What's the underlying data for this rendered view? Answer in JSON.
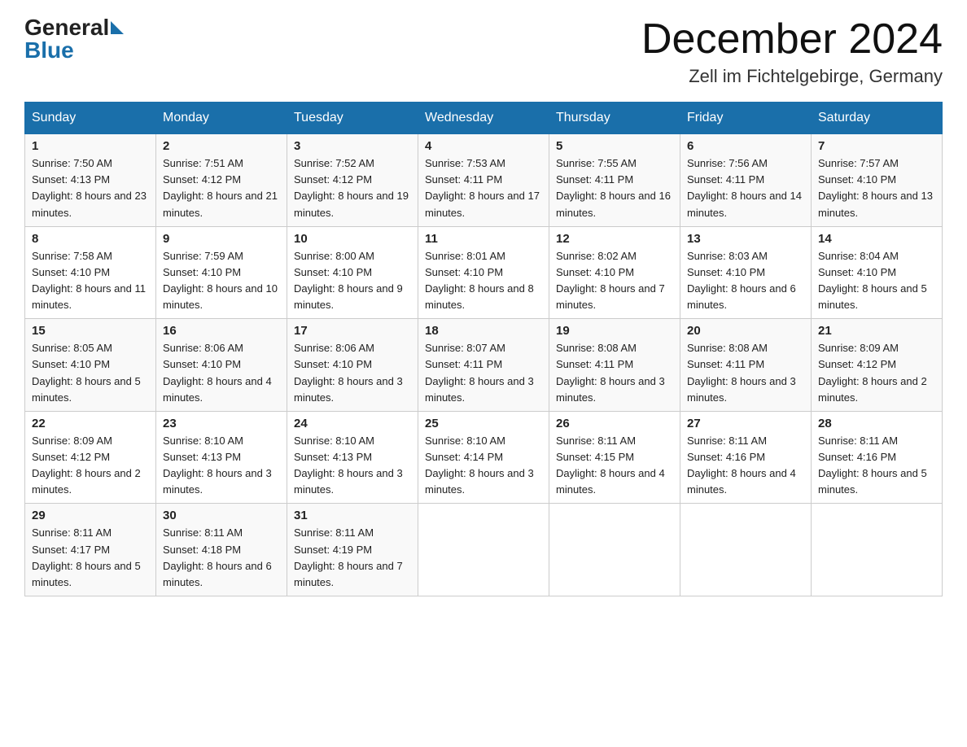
{
  "header": {
    "logo_general": "General",
    "logo_blue": "Blue",
    "month_title": "December 2024",
    "location": "Zell im Fichtelgebirge, Germany"
  },
  "days_of_week": [
    "Sunday",
    "Monday",
    "Tuesday",
    "Wednesday",
    "Thursday",
    "Friday",
    "Saturday"
  ],
  "weeks": [
    [
      {
        "day": "1",
        "sunrise": "7:50 AM",
        "sunset": "4:13 PM",
        "daylight": "8 hours and 23 minutes."
      },
      {
        "day": "2",
        "sunrise": "7:51 AM",
        "sunset": "4:12 PM",
        "daylight": "8 hours and 21 minutes."
      },
      {
        "day": "3",
        "sunrise": "7:52 AM",
        "sunset": "4:12 PM",
        "daylight": "8 hours and 19 minutes."
      },
      {
        "day": "4",
        "sunrise": "7:53 AM",
        "sunset": "4:11 PM",
        "daylight": "8 hours and 17 minutes."
      },
      {
        "day": "5",
        "sunrise": "7:55 AM",
        "sunset": "4:11 PM",
        "daylight": "8 hours and 16 minutes."
      },
      {
        "day": "6",
        "sunrise": "7:56 AM",
        "sunset": "4:11 PM",
        "daylight": "8 hours and 14 minutes."
      },
      {
        "day": "7",
        "sunrise": "7:57 AM",
        "sunset": "4:10 PM",
        "daylight": "8 hours and 13 minutes."
      }
    ],
    [
      {
        "day": "8",
        "sunrise": "7:58 AM",
        "sunset": "4:10 PM",
        "daylight": "8 hours and 11 minutes."
      },
      {
        "day": "9",
        "sunrise": "7:59 AM",
        "sunset": "4:10 PM",
        "daylight": "8 hours and 10 minutes."
      },
      {
        "day": "10",
        "sunrise": "8:00 AM",
        "sunset": "4:10 PM",
        "daylight": "8 hours and 9 minutes."
      },
      {
        "day": "11",
        "sunrise": "8:01 AM",
        "sunset": "4:10 PM",
        "daylight": "8 hours and 8 minutes."
      },
      {
        "day": "12",
        "sunrise": "8:02 AM",
        "sunset": "4:10 PM",
        "daylight": "8 hours and 7 minutes."
      },
      {
        "day": "13",
        "sunrise": "8:03 AM",
        "sunset": "4:10 PM",
        "daylight": "8 hours and 6 minutes."
      },
      {
        "day": "14",
        "sunrise": "8:04 AM",
        "sunset": "4:10 PM",
        "daylight": "8 hours and 5 minutes."
      }
    ],
    [
      {
        "day": "15",
        "sunrise": "8:05 AM",
        "sunset": "4:10 PM",
        "daylight": "8 hours and 5 minutes."
      },
      {
        "day": "16",
        "sunrise": "8:06 AM",
        "sunset": "4:10 PM",
        "daylight": "8 hours and 4 minutes."
      },
      {
        "day": "17",
        "sunrise": "8:06 AM",
        "sunset": "4:10 PM",
        "daylight": "8 hours and 3 minutes."
      },
      {
        "day": "18",
        "sunrise": "8:07 AM",
        "sunset": "4:11 PM",
        "daylight": "8 hours and 3 minutes."
      },
      {
        "day": "19",
        "sunrise": "8:08 AM",
        "sunset": "4:11 PM",
        "daylight": "8 hours and 3 minutes."
      },
      {
        "day": "20",
        "sunrise": "8:08 AM",
        "sunset": "4:11 PM",
        "daylight": "8 hours and 3 minutes."
      },
      {
        "day": "21",
        "sunrise": "8:09 AM",
        "sunset": "4:12 PM",
        "daylight": "8 hours and 2 minutes."
      }
    ],
    [
      {
        "day": "22",
        "sunrise": "8:09 AM",
        "sunset": "4:12 PM",
        "daylight": "8 hours and 2 minutes."
      },
      {
        "day": "23",
        "sunrise": "8:10 AM",
        "sunset": "4:13 PM",
        "daylight": "8 hours and 3 minutes."
      },
      {
        "day": "24",
        "sunrise": "8:10 AM",
        "sunset": "4:13 PM",
        "daylight": "8 hours and 3 minutes."
      },
      {
        "day": "25",
        "sunrise": "8:10 AM",
        "sunset": "4:14 PM",
        "daylight": "8 hours and 3 minutes."
      },
      {
        "day": "26",
        "sunrise": "8:11 AM",
        "sunset": "4:15 PM",
        "daylight": "8 hours and 4 minutes."
      },
      {
        "day": "27",
        "sunrise": "8:11 AM",
        "sunset": "4:16 PM",
        "daylight": "8 hours and 4 minutes."
      },
      {
        "day": "28",
        "sunrise": "8:11 AM",
        "sunset": "4:16 PM",
        "daylight": "8 hours and 5 minutes."
      }
    ],
    [
      {
        "day": "29",
        "sunrise": "8:11 AM",
        "sunset": "4:17 PM",
        "daylight": "8 hours and 5 minutes."
      },
      {
        "day": "30",
        "sunrise": "8:11 AM",
        "sunset": "4:18 PM",
        "daylight": "8 hours and 6 minutes."
      },
      {
        "day": "31",
        "sunrise": "8:11 AM",
        "sunset": "4:19 PM",
        "daylight": "8 hours and 7 minutes."
      },
      null,
      null,
      null,
      null
    ]
  ]
}
